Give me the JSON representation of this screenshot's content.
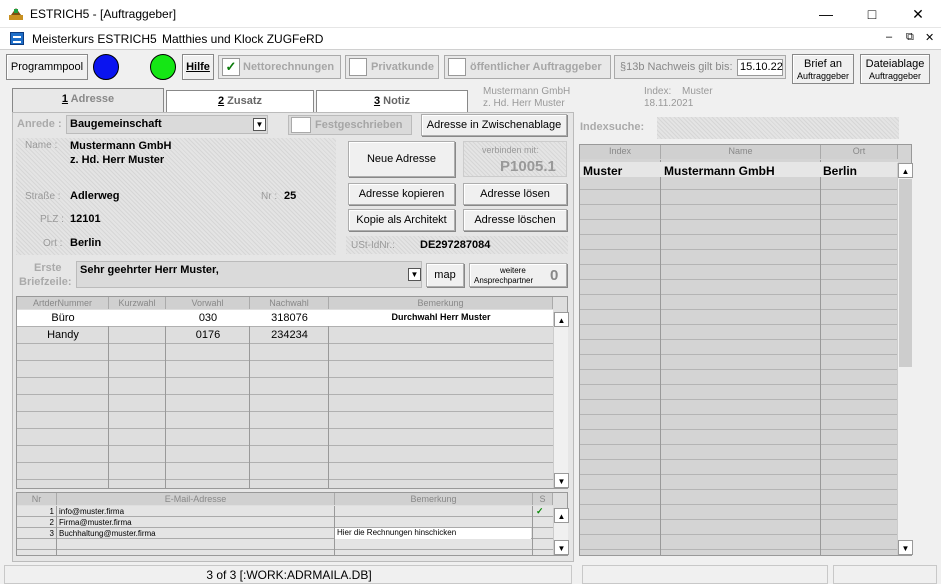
{
  "window": {
    "title": "ESTRICH5 - [Auftraggeber]"
  },
  "menubar": {
    "app": "Meisterkurs ESTRICH5",
    "company": "Matthies und Klock ZUGFeRD"
  },
  "toolbar": {
    "programmpool": "Programmpool",
    "hilfe": "Hilfe",
    "nettorechnungen": "Nettorechnungen",
    "privatkunde": "Privatkunde",
    "oeffentlich": "öffentlicher Auftraggeber",
    "nachweis_label": "§13b Nachweis gilt bis:",
    "nachweis_value": "15.10.22",
    "brief_l1": "Brief an",
    "brief_l2": "Auftraggeber",
    "datei_l1": "Dateiablage",
    "datei_l2": "Auftraggeber",
    "colors": {
      "blue": "#0a14f0",
      "green": "#15e615"
    }
  },
  "tabs": [
    {
      "num": "1",
      "label": "Adresse"
    },
    {
      "num": "2",
      "label": "Zusatz"
    },
    {
      "num": "3",
      "label": "Notiz"
    }
  ],
  "header_info": {
    "name": "Mustermann GmbH",
    "sub": "z. Hd. Herr Muster",
    "index_label": "Index:",
    "index_value": "Muster",
    "date": "18.11.2021"
  },
  "form": {
    "anrede_label": "Anrede :",
    "anrede_value": "Baugemeinschaft",
    "festgeschrieben": "Festgeschrieben",
    "zwischenablage": "Adresse in Zwischenablage",
    "name_label": "Name :",
    "name1": "Mustermann GmbH",
    "name2": "z. Hd. Herr Muster",
    "strasse_label": "Straße :",
    "strasse": "Adlerweg",
    "nr_label": "Nr :",
    "nr": "25",
    "plz_label": "PLZ :",
    "plz": "12101",
    "ort_label": "Ort :",
    "ort": "Berlin",
    "neue_adresse": "Neue Adresse",
    "verbinden_label": "verbinden mit:",
    "verbinden_value": "P1005.1",
    "kopieren": "Adresse kopieren",
    "loesen": "Adresse lösen",
    "architekt": "Kopie als Architekt",
    "loeschen": "Adresse löschen",
    "ust_label": "USt-IdNr.:",
    "ust_value": "DE297287084",
    "briefzeile_label1": "Erste",
    "briefzeile_label2": "Briefzeile:",
    "briefzeile_value": "Sehr geehrter Herr Muster,",
    "map": "map",
    "weitere_l1": "weitere",
    "weitere_l2": "Ansprechpartner",
    "weitere_count": "0"
  },
  "phone_table": {
    "headers": [
      "ArtderNummer",
      "Kurzwahl",
      "Vorwahl",
      "Nachwahl",
      "Bemerkung"
    ],
    "rows": [
      [
        "Büro",
        "",
        "030",
        "318076",
        "Durchwahl Herr Muster"
      ],
      [
        "Handy",
        "",
        "0176",
        "234234",
        ""
      ]
    ]
  },
  "email_table": {
    "headers": [
      "Nr",
      "E-Mail-Adresse",
      "Bemerkung",
      "S"
    ],
    "rows": [
      [
        "1",
        "info@muster.firma",
        "",
        "✓"
      ],
      [
        "2",
        "Firma@muster.firma",
        "",
        ""
      ],
      [
        "3",
        "Buchhaltung@muster.firma",
        "Hier die Rechnungen hinschicken",
        ""
      ]
    ]
  },
  "index_search": {
    "label": "Indexsuche:",
    "headers": [
      "Index",
      "Name",
      "Ort"
    ],
    "rows": [
      [
        "Muster",
        "Mustermann GmbH",
        "Berlin"
      ]
    ]
  },
  "statusbar": {
    "text": "3 of 3 [:WORK:ADRMAILA.DB]"
  }
}
